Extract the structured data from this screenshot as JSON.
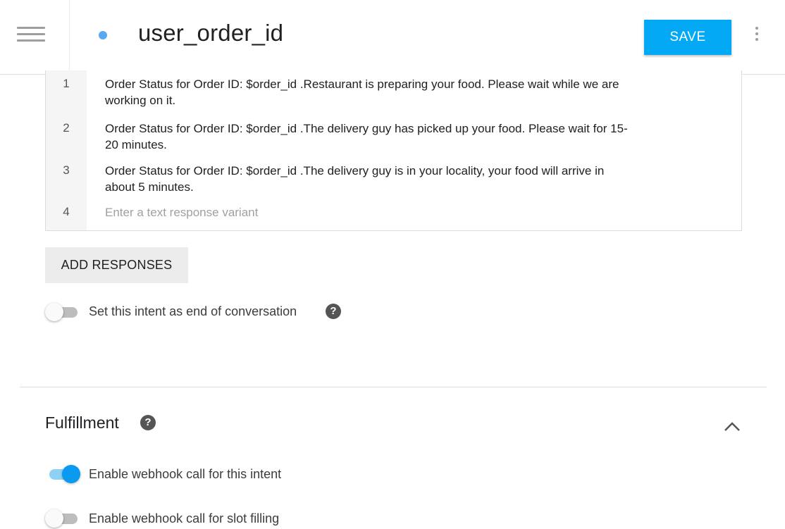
{
  "header": {
    "title": "user_order_id",
    "save_label": "SAVE"
  },
  "responses": [
    {
      "num": "1",
      "lines": [
        "Order Status for Order ID: $order_id .Restaurant is preparing your food. Please wait while we are",
        "working on it."
      ]
    },
    {
      "num": "2",
      "lines": [
        "Order Status for Order ID: $order_id .The delivery guy has picked up your food. Please wait for 15-",
        "20 minutes."
      ]
    },
    {
      "num": "3",
      "lines": [
        "Order Status for Order ID: $order_id .The delivery guy is in your locality, your food will arrive in",
        "about 5 minutes."
      ]
    }
  ],
  "new_response": {
    "num": "4",
    "placeholder": "Enter a text response variant"
  },
  "add_responses_label": "ADD RESPONSES",
  "end_conversation": {
    "label": "Set this intent as end of conversation",
    "enabled": false
  },
  "fulfillment": {
    "title": "Fulfillment",
    "webhook_intent": {
      "label": "Enable webhook call for this intent",
      "enabled": true
    },
    "webhook_slot": {
      "label": "Enable webhook call for slot filling",
      "enabled": false
    }
  },
  "icons": {
    "menu": "hamburger-icon",
    "more": "kebab-menu-icon",
    "help": "question-mark-icon",
    "collapse": "chevron-up-icon"
  },
  "colors": {
    "accent": "#03a9f4",
    "status_dot": "#5aa8ef",
    "toggle_on": "#0a9af0"
  }
}
